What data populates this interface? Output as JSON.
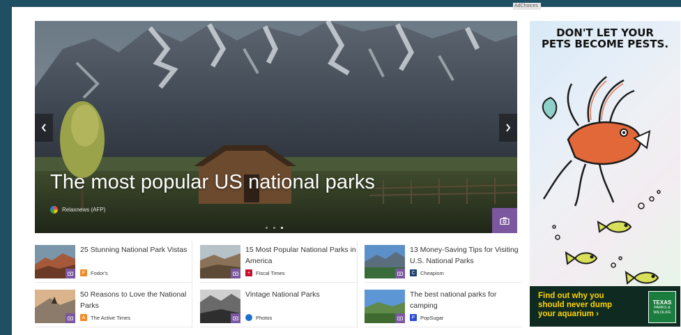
{
  "ad_choices": "AdChoices",
  "hero": {
    "title": "The most popular US national parks",
    "source": "Relaxnews (AFP)",
    "prev_icon": "chevron-left-icon",
    "next_icon": "chevron-right-icon",
    "camera_icon": "camera-icon",
    "dots": 3,
    "active_dot": 3
  },
  "stories": [
    {
      "title": "25 Stunning National Park Vistas",
      "source": "Fodor's",
      "source_icon_color": "#f08a24",
      "source_icon_char": "F"
    },
    {
      "title": "15 Most Popular National Parks in America",
      "source": "Fiscal Times",
      "source_icon_color": "#c8102e",
      "source_icon_char": "+"
    },
    {
      "title": "13 Money-Saving Tips for Visiting U.S. National Parks",
      "source": "Cheapism",
      "source_icon_color": "#1b3f6e",
      "source_icon_char": "C"
    },
    {
      "title": "50 Reasons to Love the National Parks",
      "source": "The Active Times",
      "source_icon_color": "#f08a24",
      "source_icon_char": "A"
    },
    {
      "title": "Vintage National Parks",
      "source": "Photos",
      "source_icon_color": "#1f6fd1",
      "source_icon_char": "●"
    },
    {
      "title": "The best national parks for camping",
      "source": "PopSugar",
      "source_icon_color": "#2a4ad6",
      "source_icon_char": "P"
    }
  ],
  "ad": {
    "headline_line1": "DON'T LET YOUR",
    "headline_line2": "PETS BECOME PESTS.",
    "cta_line1": "Find out why you",
    "cta_line2": "should never dump",
    "cta_line3": "your aquarium ›",
    "logo_line1": "TEXAS",
    "logo_line2": "PARKS &",
    "logo_line3": "WILDLIFE"
  },
  "colors": {
    "background": "#1f4f63",
    "accent_purple": "#7b57a0",
    "ad_footer": "#0f2a20",
    "ad_cta": "#ffd400"
  }
}
